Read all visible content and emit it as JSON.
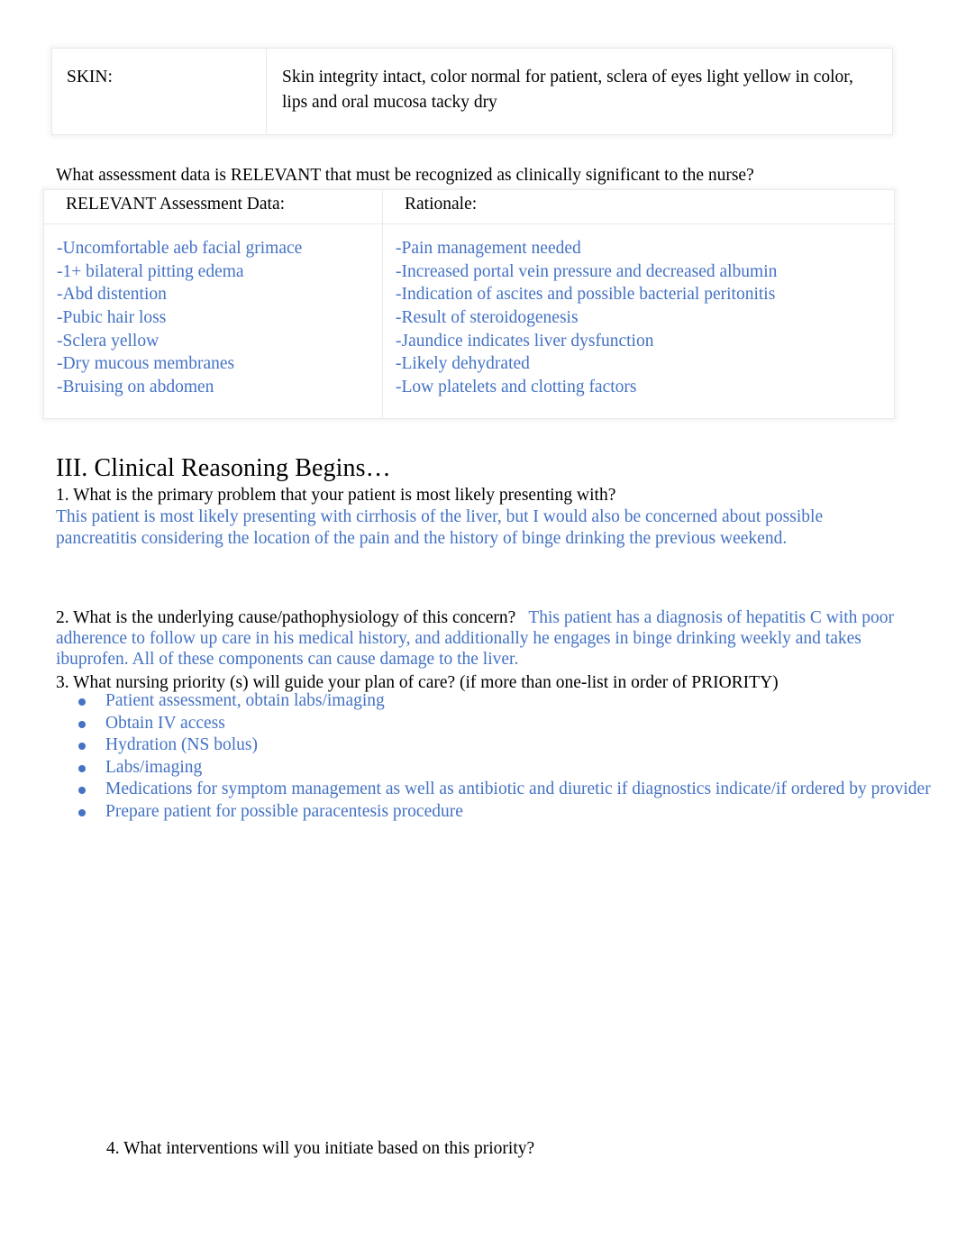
{
  "skin_table": {
    "rows": [
      {
        "label": "SKIN:",
        "value": "Skin integrity intact, color normal for patient, sclera of eyes light yellow in color, lips and oral mucosa tacky dry"
      }
    ]
  },
  "relevant_question": "What assessment data is RELEVANT that must be recognized as clinically significant to the nurse?",
  "relevant_table": {
    "headers": [
      "RELEVANT Assessment Data:",
      "Rationale:"
    ],
    "assessment_data": [
      "-Uncomfortable aeb facial grimace",
      "-1+ bilateral pitting edema",
      "-Abd distention",
      "-Pubic hair loss",
      "-Sclera yellow",
      "-Dry mucous membranes",
      "-Bruising on abdomen"
    ],
    "rationale": [
      "-Pain management needed",
      "-Increased portal vein pressure and decreased albumin",
      "-Indication of ascites and possible bacterial peritonitis",
      "-Result of steroidogenesis",
      "-Jaundice indicates liver dysfunction",
      "-Likely dehydrated",
      "-Low platelets and clotting factors"
    ]
  },
  "section": {
    "heading": "III. Clinical Reasoning Begins…",
    "q1": {
      "question": "1. What is the primary problem that your patient is most likely presenting with?",
      "answer": "This patient is most likely presenting with cirrhosis of the liver, but I would also be concerned about possible pancreatitis considering the location of the pain and the history of binge drinking the previous weekend."
    },
    "q2": {
      "question": "2. What is the underlying cause/pathophysiology of this concern?",
      "answer": "This patient has a diagnosis of hepatitis C with poor adherence to follow up care in his medical history, and additionally he engages in binge drinking weekly and takes ibuprofen. All of these components can cause damage to the liver."
    },
    "q3": {
      "question": "3. What nursing priority  (s) will guide your plan of care?  (if more than one-list in order of PRIORITY)",
      "priorities": [
        "Patient assessment, obtain labs/imaging",
        "Obtain IV access",
        "Hydration (NS bolus)",
        "Labs/imaging",
        "Medications for symptom management as well as antibiotic and diuretic if diagnostics indicate/if ordered by provider",
        "Prepare patient for possible paracentesis procedure"
      ]
    },
    "q4": {
      "question": "4. What interventions will you initiate based on this priority?"
    }
  },
  "colors": {
    "answer_blue": "#4472C4",
    "body_text": "#000000",
    "table_border": "#e9e9e9"
  }
}
